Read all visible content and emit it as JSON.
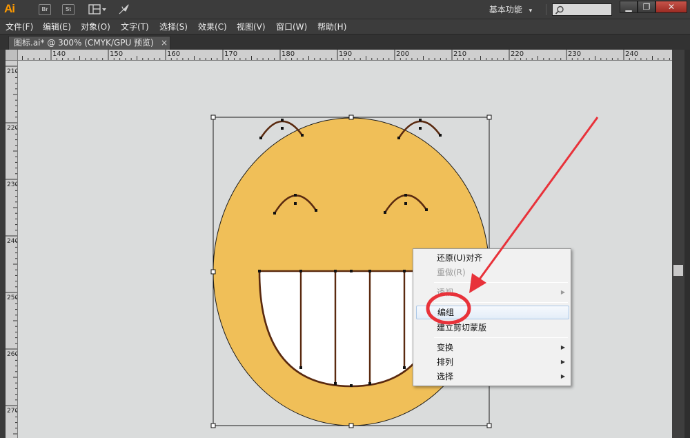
{
  "titlebar": {
    "logo": "Ai",
    "bridge_icon": "Br",
    "stock_icon": "St",
    "workspace_label": "基本功能",
    "workspace_caret": "▾",
    "search_placeholder": "",
    "minimize": "▁",
    "restore": "❐",
    "close": "✕"
  },
  "menubar": {
    "items": [
      "文件(F)",
      "编辑(E)",
      "对象(O)",
      "文字(T)",
      "选择(S)",
      "效果(C)",
      "视图(V)",
      "窗口(W)",
      "帮助(H)"
    ]
  },
  "document_tab": {
    "title": "图标.ai* @ 300% (CMYK/GPU 预览)",
    "close": "×"
  },
  "ruler_horizontal": [
    "140",
    "150",
    "160",
    "170",
    "180",
    "190",
    "200",
    "210",
    "220",
    "230",
    "240"
  ],
  "ruler_vertical": [
    "210",
    "220",
    "230",
    "240",
    "250",
    "260",
    "270"
  ],
  "context_menu": {
    "items": [
      {
        "label": "还原(U)对齐",
        "enabled": true
      },
      {
        "label": "重做(R)",
        "enabled": false
      },
      {
        "label": "透视",
        "enabled": false,
        "submenu": true
      },
      {
        "label": "编组",
        "enabled": true,
        "highlighted": true
      },
      {
        "label": "建立剪切蒙版",
        "enabled": true
      },
      {
        "label": "变换",
        "enabled": true,
        "submenu": true
      },
      {
        "label": "排列",
        "enabled": true,
        "submenu": true
      },
      {
        "label": "选择",
        "enabled": true,
        "submenu": true
      }
    ],
    "submenu_arrow": "▶"
  },
  "colors": {
    "face_fill": "#f0bf58",
    "stroke": "#5a2a10",
    "annotation_red": "#e8323a",
    "canvas_bg": "#dadcdc"
  },
  "icons": {
    "arrange_documents": "arrange-documents-icon",
    "gpu_rocket": "rocket-icon",
    "search": "search-icon"
  }
}
